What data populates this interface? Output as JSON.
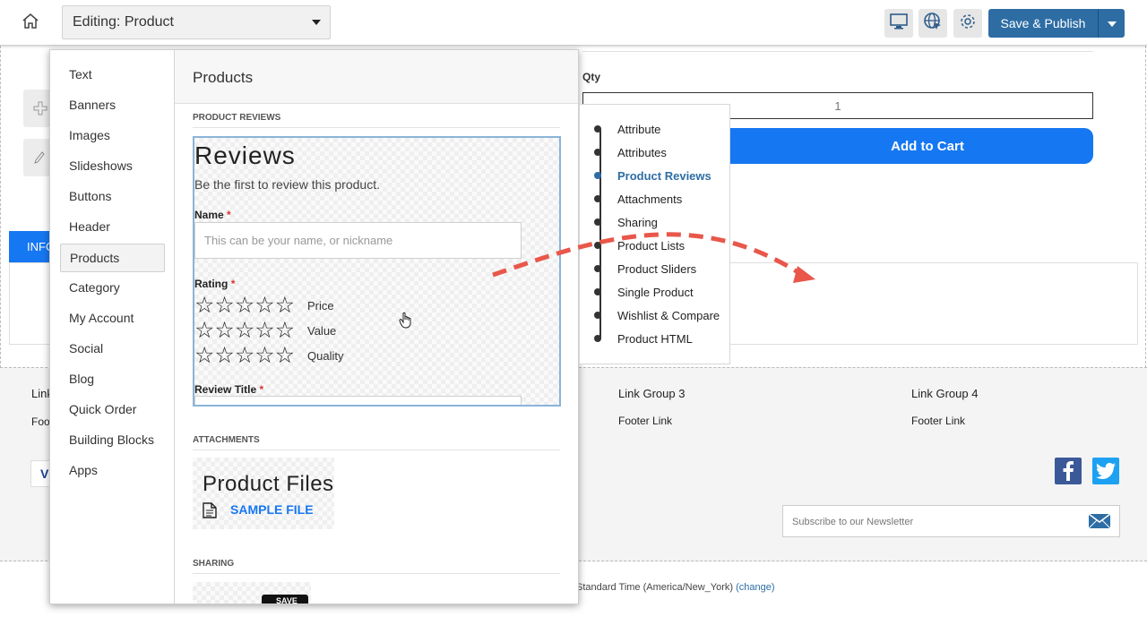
{
  "topbar": {
    "editing_label": "Editing: Product",
    "publish_label": "Save & Publish"
  },
  "page": {
    "qty_label": "Qty",
    "qty_value": "1",
    "add_to_cart": "Add to Cart",
    "info_tab": "INFO",
    "footer": {
      "link_group_1": "Link",
      "footer_link_1": "Foot",
      "link_group_3": "Link Group 3",
      "link_group_4": "Link Group 4",
      "footer_link_3": "Footer Link",
      "footer_link_4": "Footer Link",
      "newsletter_placeholder": "Subscribe to our Newsletter",
      "timezone_text": "Standard Time (America/New_York)",
      "timezone_change": "(change)",
      "visa_fragment": "V"
    }
  },
  "panel": {
    "categories": [
      {
        "label": "Text",
        "active": false
      },
      {
        "label": "Banners",
        "active": false
      },
      {
        "label": "Images",
        "active": false
      },
      {
        "label": "Slideshows",
        "active": false
      },
      {
        "label": "Buttons",
        "active": false
      },
      {
        "label": "Header",
        "active": false
      },
      {
        "label": "Products",
        "active": true
      },
      {
        "label": "Category",
        "active": false
      },
      {
        "label": "My Account",
        "active": false
      },
      {
        "label": "Social",
        "active": false
      },
      {
        "label": "Blog",
        "active": false
      },
      {
        "label": "Quick Order",
        "active": false
      },
      {
        "label": "Building Blocks",
        "active": false
      },
      {
        "label": "Apps",
        "active": false
      }
    ],
    "heading": "Products",
    "sections": {
      "product_reviews": "PRODUCT REVIEWS",
      "attachments": "ATTACHMENTS",
      "sharing": "SHARING"
    },
    "reviews_block": {
      "title": "Reviews",
      "subtitle": "Be the first to review this product.",
      "name_label": "Name",
      "name_placeholder": "This can be your name, or nickname",
      "rating_label": "Rating",
      "required_mark": "*",
      "ratings": [
        {
          "label": "Price",
          "stars": "☆☆☆☆☆"
        },
        {
          "label": "Value",
          "stars": "☆☆☆☆☆"
        },
        {
          "label": "Quality",
          "stars": "☆☆☆☆☆"
        }
      ],
      "review_title_label": "Review Title"
    },
    "files_block": {
      "title": "Product Files",
      "link": "SAMPLE FILE"
    },
    "sharing_block": {
      "save_label": "SAVE"
    }
  },
  "sublist": {
    "items": [
      {
        "label": "Attribute",
        "active": false
      },
      {
        "label": "Attributes",
        "active": false
      },
      {
        "label": "Product Reviews",
        "active": true
      },
      {
        "label": "Attachments",
        "active": false
      },
      {
        "label": "Sharing",
        "active": false
      },
      {
        "label": "Product Lists",
        "active": false
      },
      {
        "label": "Product Sliders",
        "active": false
      },
      {
        "label": "Single Product",
        "active": false
      },
      {
        "label": "Wishlist & Compare",
        "active": false
      },
      {
        "label": "Product HTML",
        "active": false
      }
    ]
  },
  "colors": {
    "accent_blue": "#1677f2",
    "publish_blue": "#2e6da4",
    "arrow_red": "#e8574a",
    "facebook": "#3b5998",
    "twitter": "#1da1f2"
  }
}
